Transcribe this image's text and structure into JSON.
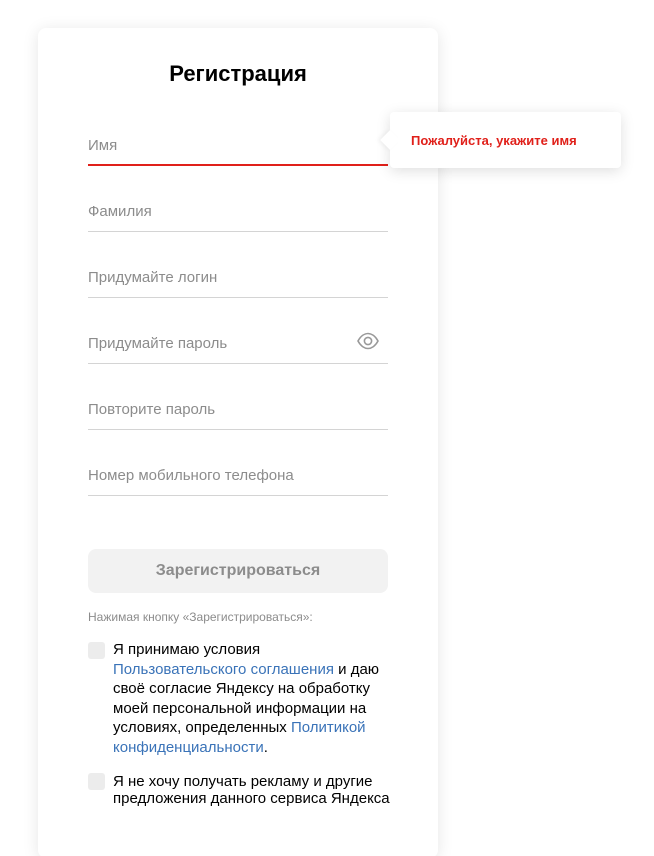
{
  "form": {
    "title": "Регистрация",
    "fields": {
      "first_name": {
        "placeholder": "Имя",
        "value": ""
      },
      "last_name": {
        "placeholder": "Фамилия",
        "value": ""
      },
      "login": {
        "placeholder": "Придумайте логин",
        "value": ""
      },
      "password": {
        "placeholder": "Придумайте пароль",
        "value": ""
      },
      "password_repeat": {
        "placeholder": "Повторите пароль",
        "value": ""
      },
      "phone": {
        "placeholder": "Номер мобильного телефона",
        "value": ""
      }
    },
    "error_tooltip": "Пожалуйста, укажите имя",
    "submit_label": "Зарегистрироваться",
    "submit_hint": "Нажимая кнопку «Зарегистрироваться»:",
    "agreement": {
      "text_1": "Я принимаю условия ",
      "link_terms": "Пользовательского соглашения",
      "text_2": " и даю своё согласие Яндексу на обработку моей персональной информации на условиях, определенных ",
      "link_privacy": "Политикой конфиденциальности",
      "text_3": "."
    },
    "no_ads": "Я не хочу получать рекламу и другие предложения данного сервиса Яндекса"
  },
  "colors": {
    "error": "#e0201a",
    "link": "#3a73b8",
    "placeholder": "#8c8c8c",
    "button_bg": "#f2f2f2"
  },
  "icons": {
    "password_toggle": "eye-icon"
  }
}
